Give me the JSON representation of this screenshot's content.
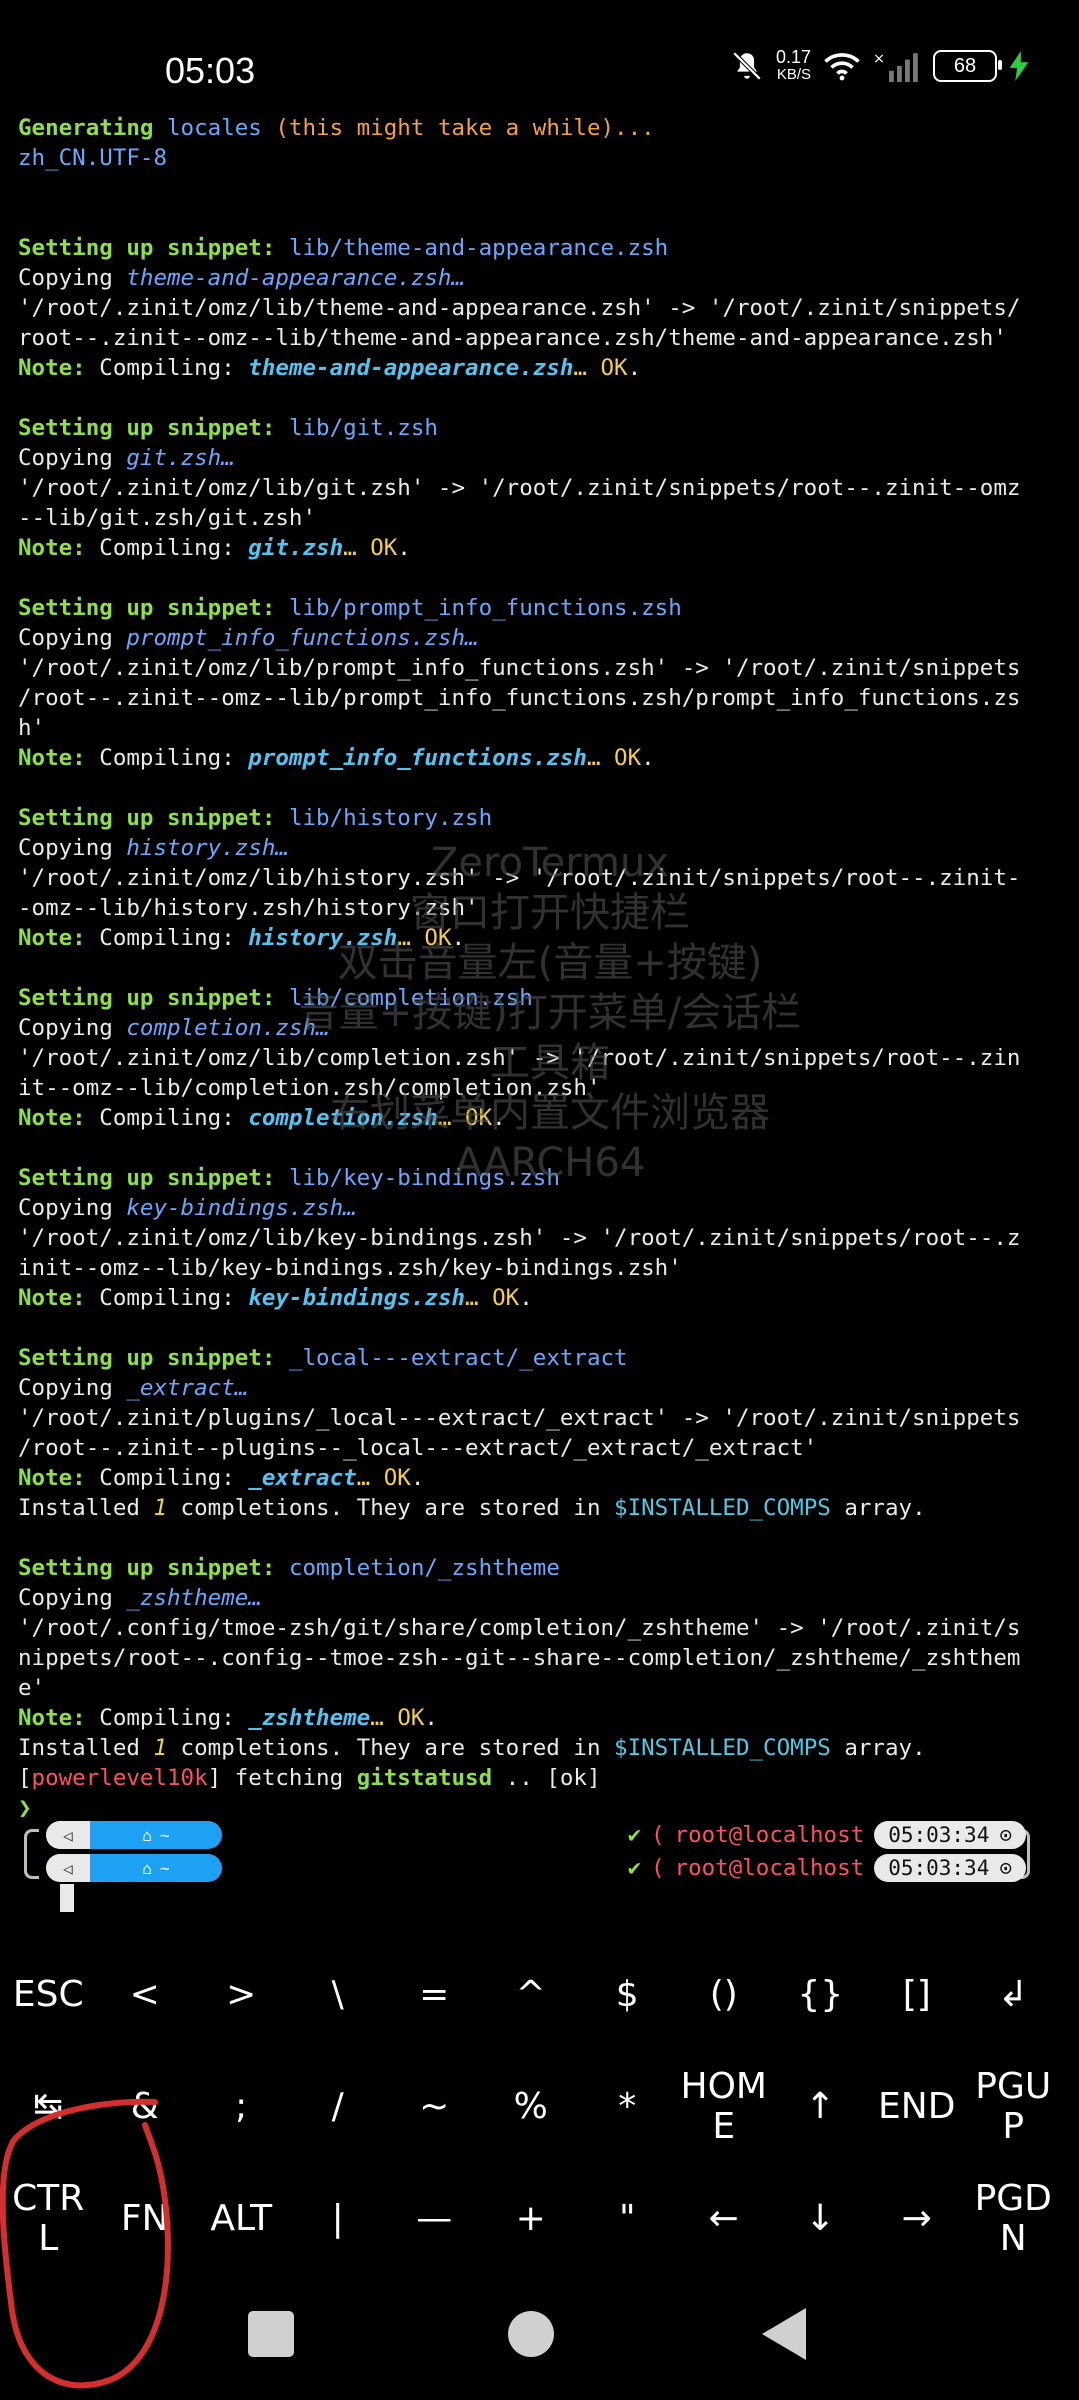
{
  "status_bar": {
    "time": "05:03",
    "net_speed": "0.17",
    "net_unit": "KB/S",
    "battery": "68"
  },
  "terminal": {
    "lines": [
      [
        {
          "t": "Generating ",
          "c": "c-green"
        },
        {
          "t": "locales ",
          "c": "c-blue"
        },
        {
          "t": "(this might take a while)...",
          "c": "c-orange"
        }
      ],
      [
        {
          "t": "zh_CN.UTF-8",
          "c": "c-blue"
        }
      ],
      [],
      [],
      [
        {
          "t": "Setting up snippet: ",
          "c": "c-green"
        },
        {
          "t": "lib/theme-and-appearance.zsh",
          "c": "c-blue"
        }
      ],
      [
        {
          "t": "Copying "
        },
        {
          "t": "theme-and-appearance.zsh…",
          "c": "c-italic"
        }
      ],
      [
        {
          "t": "'/root/.zinit/omz/lib/theme-and-appearance.zsh' -> '/root/.zinit/snippets/"
        }
      ],
      [
        {
          "t": "root--.zinit--omz--lib/theme-and-appearance.zsh/theme-and-appearance.zsh'"
        }
      ],
      [
        {
          "t": "Note: ",
          "c": "c-green"
        },
        {
          "t": "Compiling: "
        },
        {
          "t": "theme-and-appearance.zsh",
          "c": "c-italic-bold"
        },
        {
          "t": "… ",
          "c": "c-yellow"
        },
        {
          "t": "OK",
          "c": "c-yellow"
        },
        {
          "t": "."
        }
      ],
      [],
      [
        {
          "t": "Setting up snippet: ",
          "c": "c-green"
        },
        {
          "t": "lib/git.zsh",
          "c": "c-blue"
        }
      ],
      [
        {
          "t": "Copying "
        },
        {
          "t": "git.zsh…",
          "c": "c-italic"
        }
      ],
      [
        {
          "t": "'/root/.zinit/omz/lib/git.zsh' -> '/root/.zinit/snippets/root--.zinit--omz"
        }
      ],
      [
        {
          "t": "--lib/git.zsh/git.zsh'"
        }
      ],
      [
        {
          "t": "Note: ",
          "c": "c-green"
        },
        {
          "t": "Compiling: "
        },
        {
          "t": "git.zsh",
          "c": "c-italic-bold"
        },
        {
          "t": "… ",
          "c": "c-yellow"
        },
        {
          "t": "OK",
          "c": "c-yellow"
        },
        {
          "t": "."
        }
      ],
      [],
      [
        {
          "t": "Setting up snippet: ",
          "c": "c-green"
        },
        {
          "t": "lib/prompt_info_functions.zsh",
          "c": "c-blue"
        }
      ],
      [
        {
          "t": "Copying "
        },
        {
          "t": "prompt_info_functions.zsh…",
          "c": "c-italic"
        }
      ],
      [
        {
          "t": "'/root/.zinit/omz/lib/prompt_info_functions.zsh' -> '/root/.zinit/snippets"
        }
      ],
      [
        {
          "t": "/root--.zinit--omz--lib/prompt_info_functions.zsh/prompt_info_functions.zs"
        }
      ],
      [
        {
          "t": "h'"
        }
      ],
      [
        {
          "t": "Note: ",
          "c": "c-green"
        },
        {
          "t": "Compiling: "
        },
        {
          "t": "prompt_info_functions.zsh",
          "c": "c-italic-bold"
        },
        {
          "t": "… ",
          "c": "c-yellow"
        },
        {
          "t": "OK",
          "c": "c-yellow"
        },
        {
          "t": "."
        }
      ],
      [],
      [
        {
          "t": "Setting up snippet: ",
          "c": "c-green"
        },
        {
          "t": "lib/history.zsh",
          "c": "c-blue"
        }
      ],
      [
        {
          "t": "Copying "
        },
        {
          "t": "history.zsh…",
          "c": "c-italic"
        }
      ],
      [
        {
          "t": "'/root/.zinit/omz/lib/history.zsh' -> '/root/.zinit/snippets/root--.zinit-"
        }
      ],
      [
        {
          "t": "-omz--lib/history.zsh/history.zsh'"
        }
      ],
      [
        {
          "t": "Note: ",
          "c": "c-green"
        },
        {
          "t": "Compiling: "
        },
        {
          "t": "history.zsh",
          "c": "c-italic-bold"
        },
        {
          "t": "… ",
          "c": "c-yellow"
        },
        {
          "t": "OK",
          "c": "c-yellow"
        },
        {
          "t": "."
        }
      ],
      [],
      [
        {
          "t": "Setting up snippet: ",
          "c": "c-green"
        },
        {
          "t": "lib/completion.zsh",
          "c": "c-blue"
        }
      ],
      [
        {
          "t": "Copying "
        },
        {
          "t": "completion.zsh…",
          "c": "c-italic"
        }
      ],
      [
        {
          "t": "'/root/.zinit/omz/lib/completion.zsh' -> '/root/.zinit/snippets/root--.zin"
        }
      ],
      [
        {
          "t": "it--omz--lib/completion.zsh/completion.zsh'"
        }
      ],
      [
        {
          "t": "Note: ",
          "c": "c-green"
        },
        {
          "t": "Compiling: "
        },
        {
          "t": "completion.zsh",
          "c": "c-italic-bold"
        },
        {
          "t": "… ",
          "c": "c-yellow"
        },
        {
          "t": "OK",
          "c": "c-yellow"
        },
        {
          "t": "."
        }
      ],
      [],
      [
        {
          "t": "Setting up snippet: ",
          "c": "c-green"
        },
        {
          "t": "lib/key-bindings.zsh",
          "c": "c-blue"
        }
      ],
      [
        {
          "t": "Copying "
        },
        {
          "t": "key-bindings.zsh…",
          "c": "c-italic"
        }
      ],
      [
        {
          "t": "'/root/.zinit/omz/lib/key-bindings.zsh' -> '/root/.zinit/snippets/root--.z"
        }
      ],
      [
        {
          "t": "init--omz--lib/key-bindings.zsh/key-bindings.zsh'"
        }
      ],
      [
        {
          "t": "Note: ",
          "c": "c-green"
        },
        {
          "t": "Compiling: "
        },
        {
          "t": "key-bindings.zsh",
          "c": "c-italic-bold"
        },
        {
          "t": "… ",
          "c": "c-yellow"
        },
        {
          "t": "OK",
          "c": "c-yellow"
        },
        {
          "t": "."
        }
      ],
      [],
      [
        {
          "t": "Setting up snippet: ",
          "c": "c-green"
        },
        {
          "t": "_local---extract/_extract",
          "c": "c-blue"
        }
      ],
      [
        {
          "t": "Copying "
        },
        {
          "t": "_extract…",
          "c": "c-italic"
        }
      ],
      [
        {
          "t": "'/root/.zinit/plugins/_local---extract/_extract' -> '/root/.zinit/snippets"
        }
      ],
      [
        {
          "t": "/root--.zinit--plugins--_local---extract/_extract/_extract'"
        }
      ],
      [
        {
          "t": "Note: ",
          "c": "c-green"
        },
        {
          "t": "Compiling: "
        },
        {
          "t": "_extract",
          "c": "c-italic-bold"
        },
        {
          "t": "… ",
          "c": "c-yellow"
        },
        {
          "t": "OK",
          "c": "c-yellow"
        },
        {
          "t": "."
        }
      ],
      [
        {
          "t": "Installed "
        },
        {
          "t": "1",
          "c": "c-ital-num"
        },
        {
          "t": " completions. They are stored in "
        },
        {
          "t": "$INSTALLED_COMPS",
          "c": "c-cyan"
        },
        {
          "t": " array."
        }
      ],
      [],
      [
        {
          "t": "Setting up snippet: ",
          "c": "c-green"
        },
        {
          "t": "completion/_zshtheme",
          "c": "c-blue"
        }
      ],
      [
        {
          "t": "Copying "
        },
        {
          "t": "_zshtheme…",
          "c": "c-italic"
        }
      ],
      [
        {
          "t": "'/root/.config/tmoe-zsh/git/share/completion/_zshtheme' -> '/root/.zinit/s"
        }
      ],
      [
        {
          "t": "nippets/root--.config--tmoe-zsh--git--share--completion/_zshtheme/_zshthem"
        }
      ],
      [
        {
          "t": "e'"
        }
      ],
      [
        {
          "t": "Note: ",
          "c": "c-green"
        },
        {
          "t": "Compiling: "
        },
        {
          "t": "_zshtheme",
          "c": "c-italic-bold"
        },
        {
          "t": "… ",
          "c": "c-yellow"
        },
        {
          "t": "OK",
          "c": "c-yellow"
        },
        {
          "t": "."
        }
      ],
      [
        {
          "t": "Installed "
        },
        {
          "t": "1",
          "c": "c-ital-num"
        },
        {
          "t": " completions. They are stored in "
        },
        {
          "t": "$INSTALLED_COMPS",
          "c": "c-cyan"
        },
        {
          "t": " array."
        }
      ],
      [
        {
          "t": "["
        },
        {
          "t": "powerlevel10k",
          "c": "c-red"
        },
        {
          "t": "] fetching "
        },
        {
          "t": "gitstatusd",
          "c": "c-green"
        },
        {
          "t": " .. [ok]"
        }
      ],
      [
        {
          "t": "❯",
          "c": "c-green"
        }
      ]
    ]
  },
  "watermark": {
    "lines": [
      "ZeroTermux",
      "窗口打开快捷栏",
      "双击音量左(音量+按键)",
      "音量+按键)打开菜单/会话栏",
      "工具箱",
      "右划菜单内置文件浏览器",
      "AARCH64"
    ]
  },
  "prompt": {
    "rows": [
      {
        "user": "root@localhost",
        "time": "05:03:34"
      },
      {
        "user": "root@localhost",
        "time": "05:03:34"
      }
    ],
    "check": "✔",
    "paren": "(",
    "left_icon": "◁",
    "home_icon": "⌂",
    "tilde": "~",
    "clock_icon": "⊙"
  },
  "extra_keys": {
    "row1": [
      "ESC",
      "<",
      ">",
      "\\",
      "=",
      "^",
      "$",
      "()",
      "{}",
      "[]",
      "↲"
    ],
    "row2": [
      "↹",
      "&",
      ";",
      "/",
      "~",
      "%",
      "*",
      "HOM\nE",
      "↑",
      "END",
      "PGU\nP"
    ],
    "row3": [
      "CTR\nL",
      "FN",
      "ALT",
      "|",
      "—",
      "+",
      "\"",
      "←",
      "↓",
      "→",
      "PGD\nN"
    ]
  }
}
